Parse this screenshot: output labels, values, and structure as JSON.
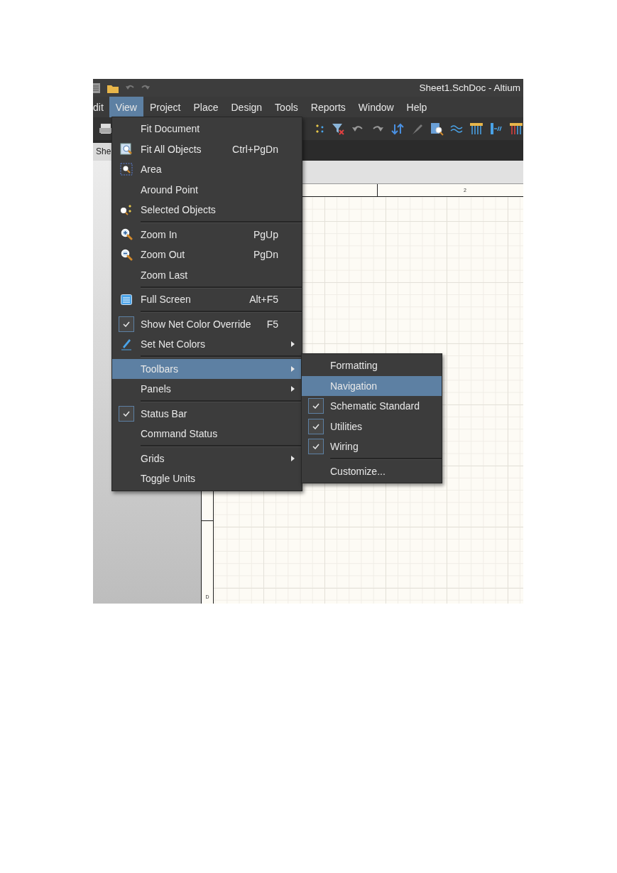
{
  "window": {
    "title": "Sheet1.SchDoc - Altium"
  },
  "menu_bar": [
    {
      "label": "dit",
      "selected": false
    },
    {
      "label": "View",
      "selected": true
    },
    {
      "label": "Project",
      "selected": false
    },
    {
      "label": "Place",
      "selected": false
    },
    {
      "label": "Design",
      "selected": false
    },
    {
      "label": "Tools",
      "selected": false
    },
    {
      "label": "Reports",
      "selected": false
    },
    {
      "label": "Window",
      "selected": false
    },
    {
      "label": "Help",
      "selected": false
    }
  ],
  "document_tab": {
    "label": "She"
  },
  "sheet": {
    "column_label": "2",
    "row_label": "D"
  },
  "view_menu": [
    {
      "kind": "item",
      "label": "Fit Document",
      "checked": false,
      "selected": false,
      "submenu": false
    },
    {
      "kind": "item",
      "label": "Fit All Objects",
      "shortcut": "Ctrl+PgDn",
      "checked": false,
      "selected": false,
      "submenu": false
    },
    {
      "kind": "item",
      "label": "Area",
      "checked": false,
      "selected": false,
      "submenu": false
    },
    {
      "kind": "item",
      "label": "Around Point",
      "checked": false,
      "selected": false,
      "submenu": false
    },
    {
      "kind": "item",
      "label": "Selected Objects",
      "checked": false,
      "selected": false,
      "submenu": false
    },
    {
      "kind": "separator"
    },
    {
      "kind": "item",
      "label": "Zoom In",
      "shortcut": "PgUp",
      "checked": false,
      "selected": false,
      "submenu": false
    },
    {
      "kind": "item",
      "label": "Zoom Out",
      "shortcut": "PgDn",
      "checked": false,
      "selected": false,
      "submenu": false
    },
    {
      "kind": "item",
      "label": "Zoom Last",
      "checked": false,
      "selected": false,
      "submenu": false
    },
    {
      "kind": "separator"
    },
    {
      "kind": "item",
      "label": "Full Screen",
      "shortcut": "Alt+F5",
      "checked": false,
      "selected": false,
      "submenu": false
    },
    {
      "kind": "separator"
    },
    {
      "kind": "item",
      "label": "Show Net Color Override",
      "shortcut": "F5",
      "checked": true,
      "selected": false,
      "submenu": false
    },
    {
      "kind": "item",
      "label": "Set Net Colors",
      "checked": false,
      "selected": false,
      "submenu": true
    },
    {
      "kind": "separator"
    },
    {
      "kind": "item",
      "label": "Toolbars",
      "checked": false,
      "selected": true,
      "submenu": true
    },
    {
      "kind": "item",
      "label": "Panels",
      "checked": false,
      "selected": false,
      "submenu": true
    },
    {
      "kind": "separator"
    },
    {
      "kind": "item",
      "label": "Status Bar",
      "checked": true,
      "selected": false,
      "submenu": false
    },
    {
      "kind": "item",
      "label": "Command Status",
      "checked": false,
      "selected": false,
      "submenu": false
    },
    {
      "kind": "separator"
    },
    {
      "kind": "item",
      "label": "Grids",
      "checked": false,
      "selected": false,
      "submenu": true
    },
    {
      "kind": "item",
      "label": "Toggle Units",
      "checked": false,
      "selected": false,
      "submenu": false
    }
  ],
  "toolbars_submenu": [
    {
      "kind": "item",
      "label": "Formatting",
      "checked": false,
      "selected": false
    },
    {
      "kind": "item",
      "label": "Navigation",
      "checked": false,
      "selected": true
    },
    {
      "kind": "item",
      "label": "Schematic Standard",
      "checked": true,
      "selected": false
    },
    {
      "kind": "item",
      "label": "Utilities",
      "checked": true,
      "selected": false
    },
    {
      "kind": "item",
      "label": "Wiring",
      "checked": true,
      "selected": false
    },
    {
      "kind": "separator"
    },
    {
      "kind": "item",
      "label": "Customize...",
      "checked": false,
      "selected": false
    }
  ]
}
